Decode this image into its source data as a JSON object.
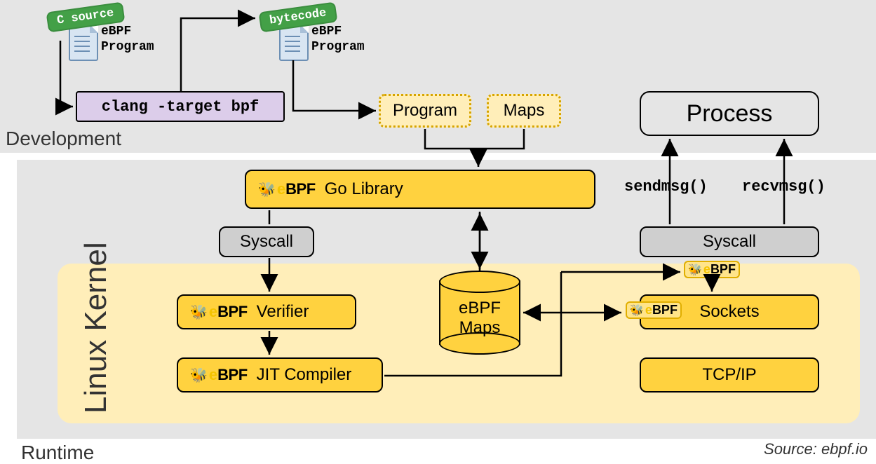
{
  "regions": {
    "development": "Development",
    "runtime": "Runtime",
    "kernel": "Linux Kernel"
  },
  "source": "Source: ebpf.io",
  "tags": {
    "csource": "C source",
    "bytecode": "bytecode"
  },
  "file": {
    "label_line1": "eBPF",
    "label_line2": "Program"
  },
  "dev": {
    "clang": "clang -target bpf",
    "program": "Program",
    "maps": "Maps"
  },
  "runtime": {
    "go_library": "Go Library",
    "syscall": "Syscall",
    "verifier": "Verifier",
    "jit": "JIT Compiler",
    "ebpf_maps_l1": "eBPF",
    "ebpf_maps_l2": "Maps",
    "sockets": "Sockets",
    "tcpip": "TCP/IP",
    "process": "Process",
    "sendmsg": "sendmsg()",
    "recvmsg": "recvmsg()"
  },
  "ebpf_logo": {
    "e": "e",
    "bpf": "BPF"
  }
}
